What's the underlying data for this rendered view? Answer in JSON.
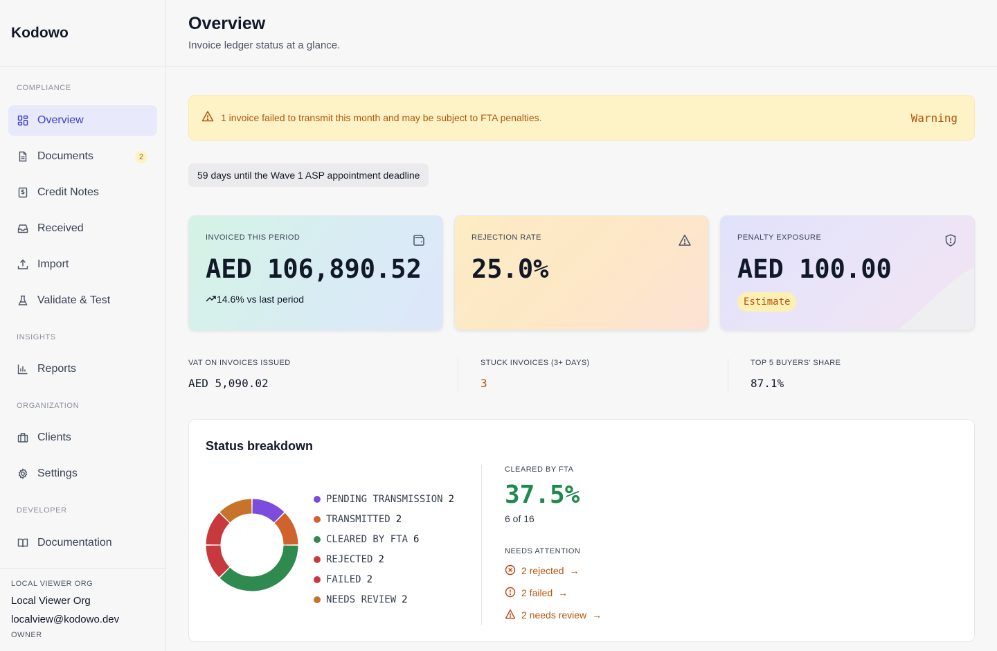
{
  "brand": "Kodowo",
  "nav": {
    "sections": [
      "COMPLIANCE",
      "INSIGHTS",
      "ORGANIZATION",
      "DEVELOPER"
    ],
    "items": [
      {
        "label": "Overview",
        "icon": "dashboard-icon",
        "active": true
      },
      {
        "label": "Documents",
        "icon": "document-icon",
        "badge": "2"
      },
      {
        "label": "Credit Notes",
        "icon": "receipt-icon"
      },
      {
        "label": "Received",
        "icon": "inbox-icon"
      },
      {
        "label": "Import",
        "icon": "upload-icon"
      },
      {
        "label": "Validate & Test",
        "icon": "flask-icon"
      },
      {
        "label": "Reports",
        "icon": "bar-chart-icon"
      },
      {
        "label": "Clients",
        "icon": "briefcase-icon"
      },
      {
        "label": "Settings",
        "icon": "gear-icon"
      },
      {
        "label": "Documentation",
        "icon": "book-icon"
      }
    ]
  },
  "account": {
    "org_label": "LOCAL VIEWER ORG",
    "org_name": "Local Viewer Org",
    "email": "localview@kodowo.dev",
    "role": "OWNER"
  },
  "header": {
    "title": "Overview",
    "subtitle": "Invoice ledger status at a glance."
  },
  "banner": {
    "message": "1 invoice failed to transmit this month and may be subject to FTA penalties.",
    "level": "Warning",
    "icon": "warning-icon"
  },
  "deadline": "59 days until the Wave 1 ASP appointment deadline",
  "kpis": [
    {
      "label": "INVOICED THIS PERIOD",
      "value": "AED 106,890.52",
      "sub": "14.6% vs last period",
      "icon": "wallet-icon"
    },
    {
      "label": "REJECTION RATE",
      "value": "25.0%",
      "icon": "warning-icon"
    },
    {
      "label": "PENALTY EXPOSURE",
      "value": "AED 100.00",
      "tag": "Estimate",
      "icon": "shield-icon"
    }
  ],
  "stats": [
    {
      "label": "VAT ON INVOICES ISSUED",
      "value": "AED 5,090.02"
    },
    {
      "label": "STUCK INVOICES (3+ DAYS)",
      "value": "3"
    },
    {
      "label": "TOP 5 BUYERS' SHARE",
      "value": "87.1%"
    }
  ],
  "status": {
    "title": "Status breakdown",
    "cleared_label": "CLEARED BY FTA",
    "cleared_pct": "37.5%",
    "cleared_of": "6 of 16",
    "attention_label": "NEEDS ATTENTION",
    "attention": [
      {
        "label": "2 rejected",
        "icon": "x-circle-icon"
      },
      {
        "label": "2 failed",
        "icon": "alert-circle-icon"
      },
      {
        "label": "2 needs review",
        "icon": "warning-icon"
      }
    ],
    "arrow": "→"
  },
  "chart_data": {
    "type": "pie",
    "donut": true,
    "categories": [
      "PENDING TRANSMISSION",
      "TRANSMITTED",
      "CLEARED BY FTA",
      "REJECTED",
      "FAILED",
      "NEEDS REVIEW"
    ],
    "values": [
      2,
      2,
      6,
      2,
      2,
      2
    ],
    "colors": [
      "#7c4ddc",
      "#d0632c",
      "#2e8a4f",
      "#c8393e",
      "#c8393e",
      "#c7742a"
    ],
    "legend": "right"
  },
  "colors": {
    "accent": "#3b3fc9",
    "warning": "#b45309",
    "success": "#1f8a4c"
  }
}
